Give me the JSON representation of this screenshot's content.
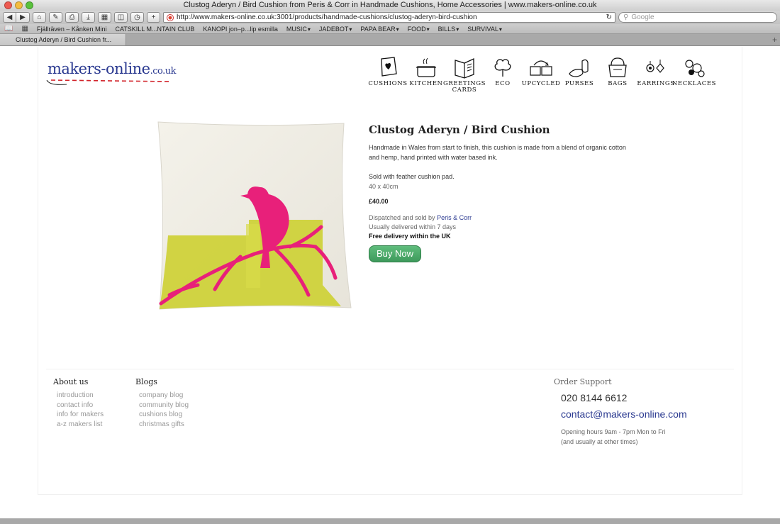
{
  "window": {
    "title": "Clustog Aderyn / Bird Cushion from Peris & Corr in Handmade Cushions, Home Accessories | www.makers-online.co.uk"
  },
  "toolbar": {
    "url": "http://www.makers-online.co.uk:3001/products/handmade-cushions/clustog-aderyn-bird-cushion",
    "search_placeholder": "Google"
  },
  "bookmarks": [
    "Fjällräven – Kånken Mini",
    "CATSKILL M...NTAIN CLUB",
    "KANOPI jon–p...lip esmilla",
    "MUSIC",
    "JADEBOT",
    "PAPA BEAR",
    "FOOD",
    "BILLS",
    "SURVIVAL"
  ],
  "tab": {
    "label": "Clustog Aderyn / Bird Cushion fr..."
  },
  "site": {
    "logo_main": "makers-online",
    "logo_suffix": ".co.uk",
    "nav": [
      {
        "line1": "Cushions",
        "line2": ""
      },
      {
        "line1": "Kitchen",
        "line2": ""
      },
      {
        "line1": "Greetings",
        "line2": "Cards"
      },
      {
        "line1": "Eco",
        "line2": ""
      },
      {
        "line1": "Upcycled",
        "line2": ""
      },
      {
        "line1": "Purses",
        "line2": ""
      },
      {
        "line1": "Bags",
        "line2": ""
      },
      {
        "line1": "Earrings",
        "line2": ""
      },
      {
        "line1": "Necklaces",
        "line2": ""
      }
    ]
  },
  "product": {
    "title": "Clustog Aderyn / Bird Cushion",
    "description": "Handmade in Wales from start to finish, this cushion is made from a blend of organic cotton and hemp, hand printed with water based ink.",
    "pad": "Sold with feather cushion pad.",
    "size": "40 x 40cm",
    "price": "£40.00",
    "dispatched_prefix": "Dispatched and sold by ",
    "seller": "Peris & Corr",
    "delivery": "Usually delivered within 7 days",
    "free_delivery": "Free delivery within the UK",
    "buy_label": "Buy Now"
  },
  "footer": {
    "about_title": "About us",
    "about_links": [
      "introduction",
      "contact info",
      "info for makers",
      "a-z makers list"
    ],
    "blogs_title": "Blogs",
    "blogs_links": [
      "company blog",
      "community blog",
      "cushions blog",
      "christmas gifts"
    ],
    "support_title": "Order Support",
    "phone": "020 8144 6612",
    "email": "contact@makers-online.com",
    "hours_line1": "Opening hours 9am - 7pm Mon to Fri",
    "hours_line2": "(and usually at other times)"
  },
  "colors": {
    "brand_blue": "#2a3990",
    "buy_green": "#4caf6a",
    "cushion_pink": "#e8207a",
    "cushion_yellow": "#cfd23a"
  }
}
